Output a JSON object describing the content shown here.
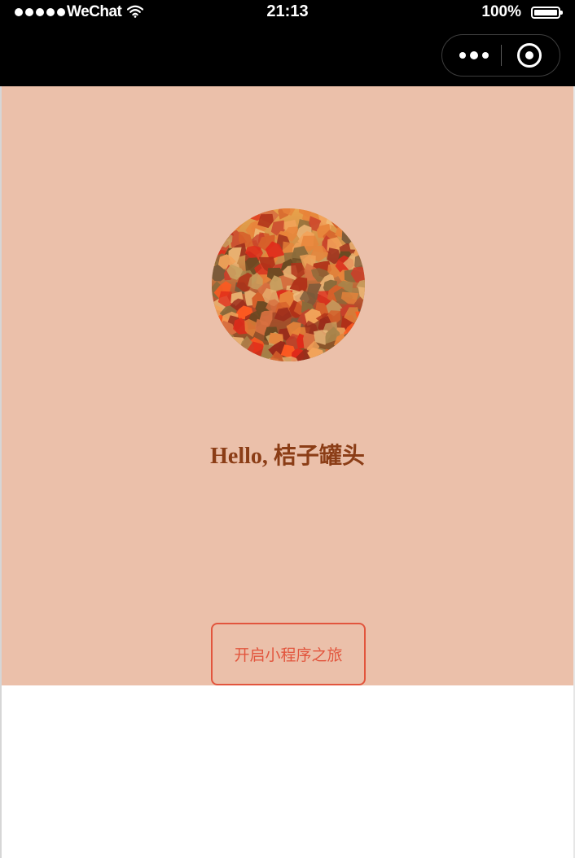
{
  "status_bar": {
    "carrier": "WeChat",
    "time": "21:13",
    "battery": "100%"
  },
  "nav_bar": {
    "more_icon": "more-dots-icon",
    "close_icon": "close-target-icon"
  },
  "content": {
    "background_color": "#ebc0aa",
    "avatar_icon": "avatar-image",
    "greeting": "Hello, 桔子罐头",
    "greeting_color": "#8b3d16",
    "start_button_label": "开启小程序之旅",
    "button_color": "#e2553d"
  }
}
